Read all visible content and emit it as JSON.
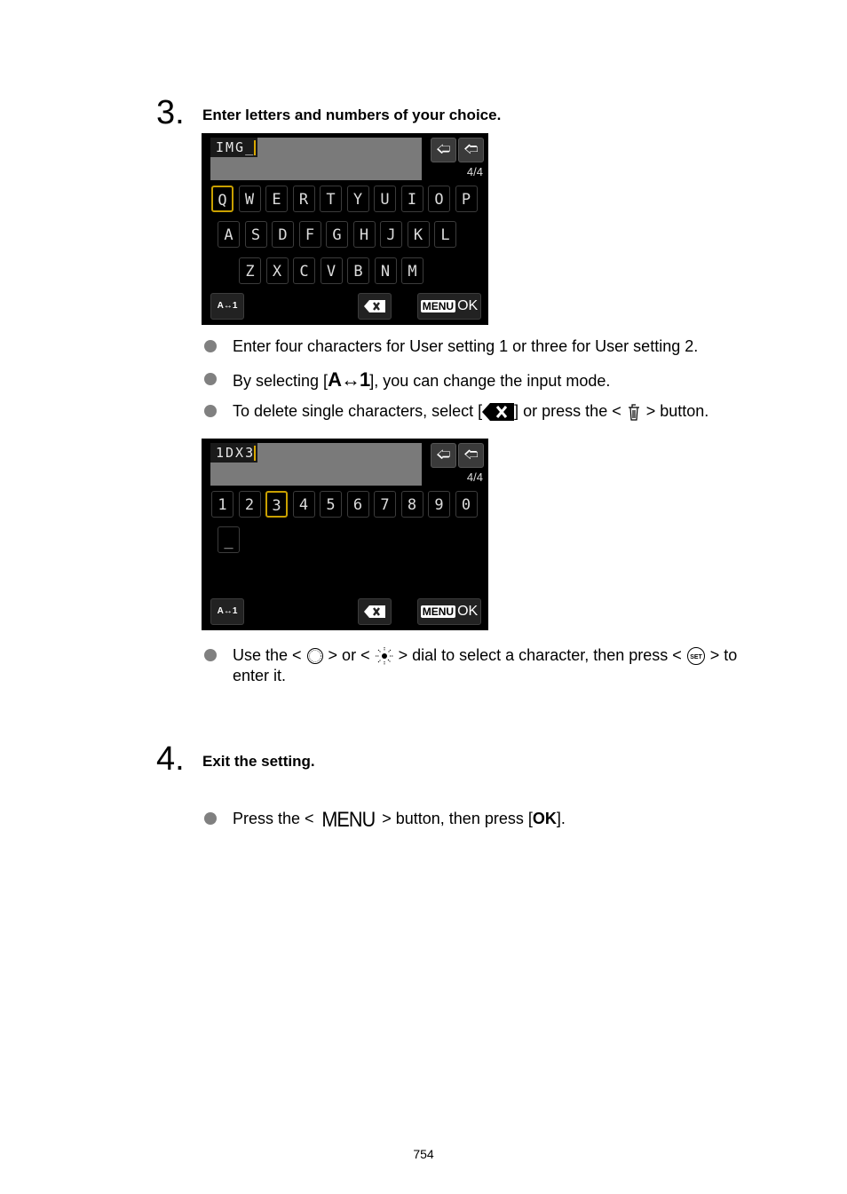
{
  "steps": [
    {
      "number": "3.",
      "title": "Enter letters and numbers of your choice.",
      "screen1": {
        "input_text": "IMG_",
        "position": "4/4",
        "rows": [
          [
            "Q",
            "W",
            "E",
            "R",
            "T",
            "Y",
            "U",
            "I",
            "O",
            "P"
          ],
          [
            "A",
            "S",
            "D",
            "F",
            "G",
            "H",
            "J",
            "K",
            "L"
          ],
          [
            "Z",
            "X",
            "C",
            "V",
            "B",
            "N",
            "M"
          ]
        ],
        "selected_key": "Q",
        "mode_button": "A↔1",
        "menu_label": "MENU",
        "ok_label": "OK"
      },
      "bullets_a": [
        "Enter four characters for User setting 1 or three for User setting 2.",
        {
          "before": "By selecting [",
          "icon": "A↔1",
          "after": "], you can change the input mode."
        },
        {
          "before": "To delete single characters, select [",
          "mid": "] or press the < ",
          "after": " > button."
        }
      ],
      "screen2": {
        "input_text": "1DX3",
        "position": "4/4",
        "rows": [
          [
            "1",
            "2",
            "3",
            "4",
            "5",
            "6",
            "7",
            "8",
            "9",
            "0"
          ],
          [
            "_"
          ]
        ],
        "selected_key": "3",
        "mode_button": "A↔1",
        "menu_label": "MENU",
        "ok_label": "OK"
      },
      "bullet_b": {
        "p1": "Use the < ",
        "p2": " > or < ",
        "p3": " > dial to select a character, then press < ",
        "p4": " > to enter it."
      }
    },
    {
      "number": "4.",
      "title": "Exit the setting.",
      "bullet": {
        "before": "Press the < ",
        "menu": "MENU",
        "mid": " > button, then press [",
        "ok": "OK",
        "after": "]."
      }
    }
  ],
  "page_number": "754"
}
